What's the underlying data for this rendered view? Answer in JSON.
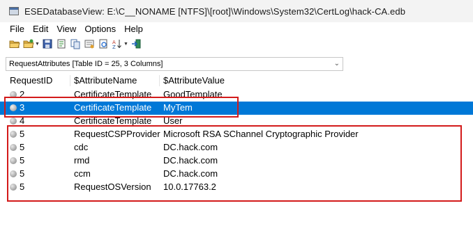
{
  "window": {
    "title": "ESEDatabaseView:   E:\\C__NONAME [NTFS]\\[root]\\Windows\\System32\\CertLog\\hack-CA.edb"
  },
  "menu": [
    "File",
    "Edit",
    "View",
    "Options",
    "Help"
  ],
  "toolbar": {
    "icons": [
      "open-folder-icon",
      "open-recent-icon",
      "save-icon",
      "export-icon",
      "copy-icon",
      "properties-icon",
      "html-report-icon",
      "sort-icon",
      "exit-icon"
    ]
  },
  "table_selector": {
    "value": "RequestAttributes   [Table ID = 25, 3 Columns]"
  },
  "grid": {
    "columns": [
      "RequestID",
      "$AttributeName",
      "$AttributeValue"
    ],
    "rows": [
      {
        "id": "2",
        "name": "CertificateTemplate",
        "value": "GoodTemplate",
        "selected": false
      },
      {
        "id": "3",
        "name": "CertificateTemplate",
        "value": "MyTem",
        "selected": true
      },
      {
        "id": "4",
        "name": "CertificateTemplate",
        "value": "User",
        "selected": false
      },
      {
        "id": "5",
        "name": "RequestCSPProvider",
        "value": "Microsoft RSA SChannel Cryptographic Provider",
        "selected": false
      },
      {
        "id": "5",
        "name": "cdc",
        "value": "DC.hack.com",
        "selected": false
      },
      {
        "id": "5",
        "name": "rmd",
        "value": "DC.hack.com",
        "selected": false
      },
      {
        "id": "5",
        "name": "ccm",
        "value": "DC.hack.com",
        "selected": false
      },
      {
        "id": "5",
        "name": "RequestOSVersion",
        "value": "10.0.17763.2",
        "selected": false
      }
    ]
  },
  "colors": {
    "selection": "#0078d7",
    "annotation": "#d31a1a"
  }
}
